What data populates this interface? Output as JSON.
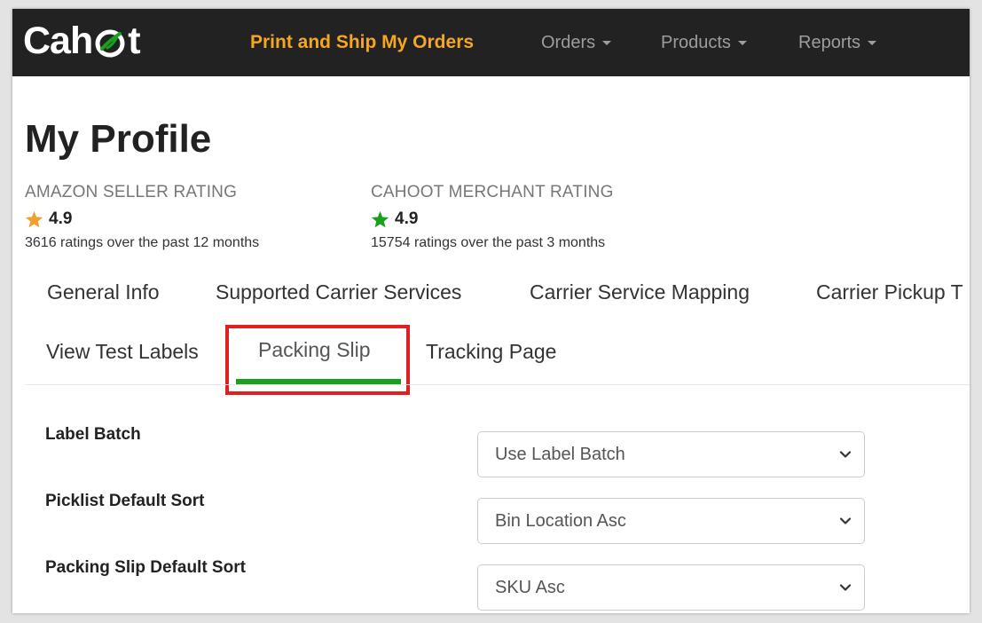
{
  "navbar": {
    "logo": {
      "prefix": "Cah",
      "suffix": "t"
    },
    "primary_link": "Print and Ship My Orders",
    "menus": [
      {
        "label": "Orders"
      },
      {
        "label": "Products"
      },
      {
        "label": "Reports"
      }
    ]
  },
  "page": {
    "title": "My Profile"
  },
  "ratings": [
    {
      "title": "AMAZON SELLER RATING",
      "score": "4.9",
      "count": "3616 ratings over the past 12 months",
      "star_color": "#f0a030"
    },
    {
      "title": "CAHOOT MERCHANT RATING",
      "score": "4.9",
      "count": "15754 ratings over the past 3 months",
      "star_color": "#1aa01a"
    }
  ],
  "tabs": {
    "row1": [
      "General Info",
      "Supported Carrier Services",
      "Carrier Service Mapping",
      "Carrier Pickup T"
    ],
    "row2": [
      "View Test Labels",
      "Packing Slip",
      "Tracking Page"
    ],
    "active": "Packing Slip"
  },
  "form": {
    "fields": [
      {
        "label": "Label Batch",
        "value": "Use Label Batch"
      },
      {
        "label": "Picklist Default Sort",
        "value": "Bin Location Asc"
      },
      {
        "label": "Packing Slip Default Sort",
        "value": "SKU Asc"
      }
    ]
  },
  "colors": {
    "navbar_bg": "#222222",
    "brand_orange": "#f5a623",
    "active_tab_underline": "#1aa01a",
    "highlight_box": "#e02020"
  }
}
